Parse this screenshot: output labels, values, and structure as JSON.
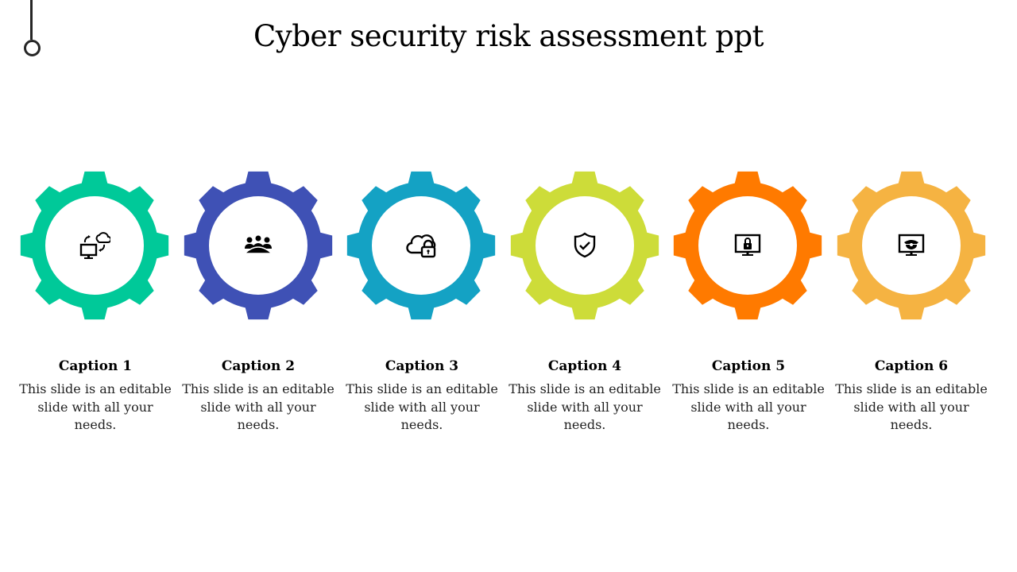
{
  "slide": {
    "title": "Cyber security risk assessment ppt"
  },
  "steps": [
    {
      "caption": "Caption 1",
      "text": "This slide is an editable slide with all your needs.",
      "color": "#00C999",
      "icon": "cloud-sync-computer-icon"
    },
    {
      "caption": "Caption 2",
      "text": "This slide is an editable slide with all your needs.",
      "color": "#3F51B5",
      "icon": "team-meeting-icon"
    },
    {
      "caption": "Caption 3",
      "text": "This slide is an editable slide with all your needs.",
      "color": "#14A2C4",
      "icon": "cloud-lock-icon"
    },
    {
      "caption": "Caption 4",
      "text": "This slide is an editable slide with all your needs.",
      "color": "#CDDC39",
      "icon": "shield-check-icon"
    },
    {
      "caption": "Caption 5",
      "text": "This slide is an editable slide with all your needs.",
      "color": "#FF7A00",
      "icon": "monitor-lock-icon"
    },
    {
      "caption": "Caption 6",
      "text": "This slide is an editable slide with all your needs.",
      "color": "#F5B342",
      "icon": "monitor-police-icon"
    }
  ]
}
